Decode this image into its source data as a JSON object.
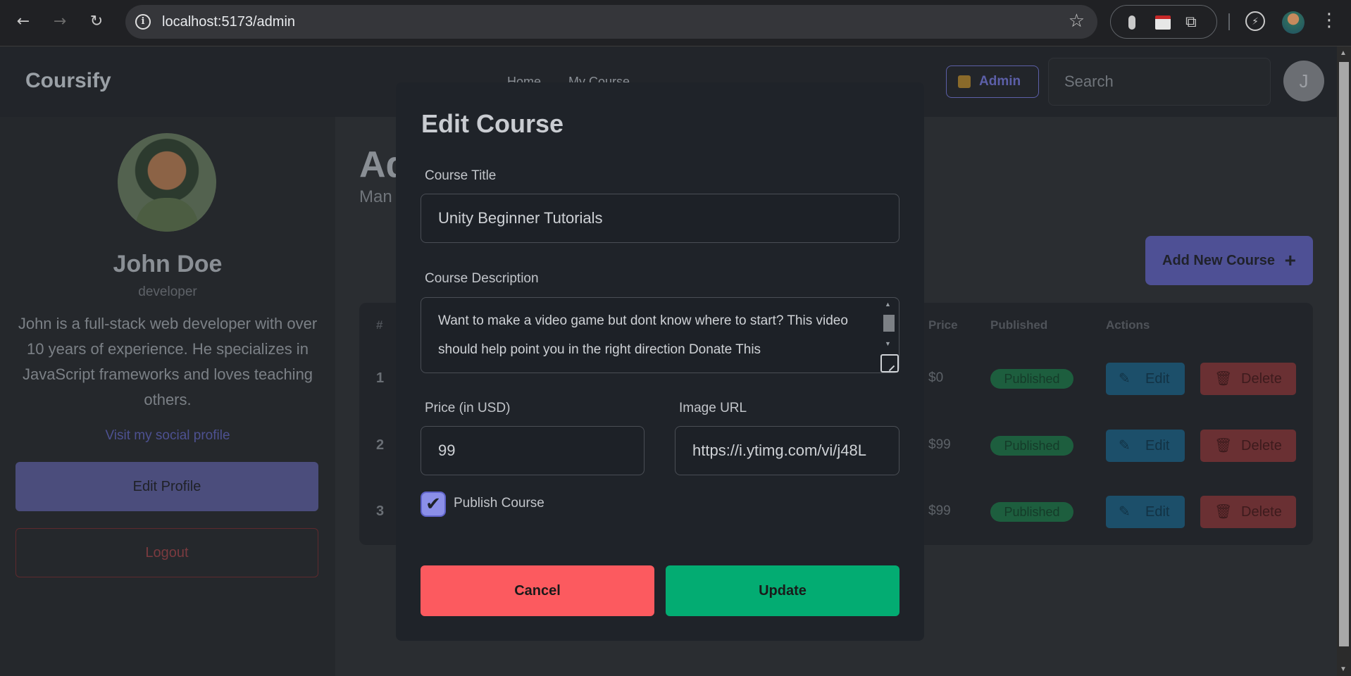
{
  "browser": {
    "url": "localhost:5173/admin",
    "back_icon": "←",
    "forward_icon": "→",
    "reload_icon": "↻",
    "info_icon": "i",
    "star_icon": "☆",
    "extensions_icon": "⧉",
    "menu_icon": "⋮",
    "perf_icon": "⚡"
  },
  "header": {
    "brand": "Coursify",
    "nav": [
      "Home",
      "My Course"
    ],
    "admin_label": "Admin",
    "search_placeholder": "Search",
    "avatar_initial": "J"
  },
  "profile": {
    "name": "John Doe",
    "role": "developer",
    "bio": "John is a full-stack web developer with over 10 years of experience. He specializes in JavaScript frameworks and loves teaching others.",
    "social_link": "Visit my social profile",
    "edit_label": "Edit Profile",
    "logout_label": "Logout"
  },
  "main": {
    "title_partial": "Ad",
    "subtitle_partial": "Man",
    "add_course_label": "Add New Course",
    "add_icon": "+",
    "columns": [
      "#",
      "Price",
      "Published",
      "Actions"
    ],
    "rows": [
      {
        "num": "1",
        "price": "$0",
        "status": "Published"
      },
      {
        "num": "2",
        "price": "$99",
        "status": "Published"
      },
      {
        "num": "3",
        "price": "$99",
        "status": "Published"
      }
    ],
    "edit_label": "Edit",
    "delete_label": "Delete",
    "edit_icon": "✎",
    "delete_icon": "🗑"
  },
  "modal": {
    "title": "Edit Course",
    "course_title_label": "Course Title",
    "course_title_value": "Unity Beginner Tutorials",
    "description_label": "Course Description",
    "description_value": "Want to make a video game but dont know where to start? This video should help point you in the right direction Donate This",
    "price_label": "Price (in USD)",
    "price_value": "99",
    "image_label": "Image URL",
    "image_value": "https://i.ytimg.com/vi/j48L",
    "publish_label": "Publish Course",
    "publish_checked": true,
    "check_icon": "✔",
    "cancel_label": "Cancel",
    "update_label": "Update"
  },
  "colors": {
    "cancel": "#fc5a5f",
    "update": "#03ac72",
    "checkbox": "#8b8fe8",
    "modal_bg": "#1f2329"
  }
}
